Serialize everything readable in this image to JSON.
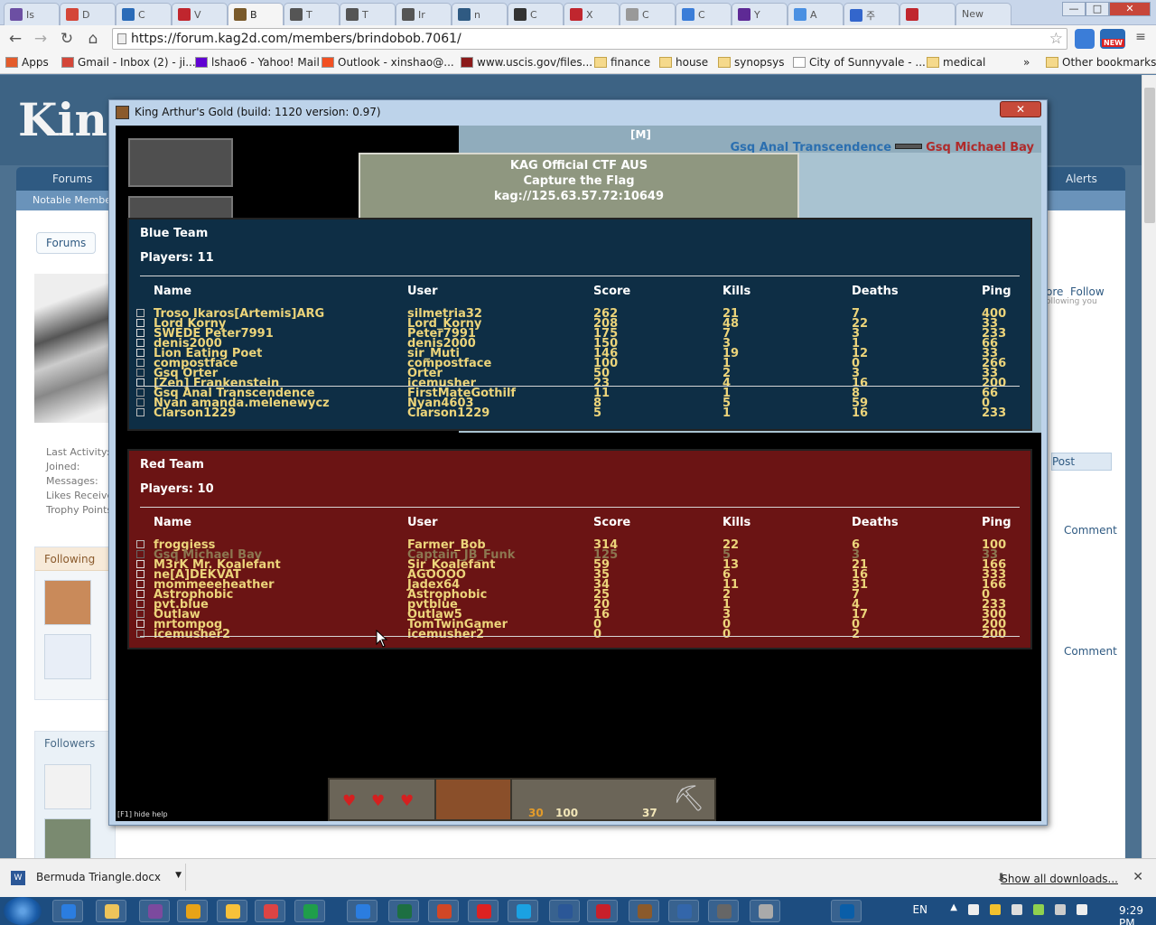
{
  "browser": {
    "tabs": [
      {
        "label": "Is",
        "color": "#6c4fa3"
      },
      {
        "label": "D",
        "color": "#d44638"
      },
      {
        "label": "C",
        "color": "#2a6bb8"
      },
      {
        "label": "V",
        "color": "#c0262e"
      },
      {
        "label": "B",
        "color": "#7a5a2a",
        "active": true
      },
      {
        "label": "T",
        "color": "#555555"
      },
      {
        "label": "T",
        "color": "#555555"
      },
      {
        "label": "Ir",
        "color": "#555555"
      },
      {
        "label": "n",
        "color": "#2f5a82"
      },
      {
        "label": "C",
        "color": "#333333"
      },
      {
        "label": "X",
        "color": "#c0262e"
      },
      {
        "label": "C",
        "color": "#999999"
      },
      {
        "label": "C",
        "color": "#3b7dd8"
      },
      {
        "label": "Y",
        "color": "#5e2a95"
      },
      {
        "label": "A",
        "color": "#4a90e2"
      },
      {
        "label": "주",
        "color": "#3366cc"
      },
      {
        "label": "",
        "color": "#c0262e"
      },
      {
        "label": "New",
        "color": ""
      }
    ],
    "url": "https://forum.kag2d.com/members/brindobob.7061/",
    "bookmarks": [
      {
        "label": "Apps",
        "kind": "apps"
      },
      {
        "label": "Gmail - Inbox (2) - ji...",
        "kind": "gmail"
      },
      {
        "label": "lshao6 - Yahoo! Mail",
        "kind": "yahoo"
      },
      {
        "label": "Outlook - xinshao@...",
        "kind": "ms"
      },
      {
        "label": "www.uscis.gov/files...",
        "kind": "gov"
      },
      {
        "label": "finance",
        "kind": "folder"
      },
      {
        "label": "house",
        "kind": "folder"
      },
      {
        "label": "synopsys",
        "kind": "folder"
      },
      {
        "label": "City of Sunnyvale - ...",
        "kind": "page"
      },
      {
        "label": "medical",
        "kind": "folder"
      }
    ],
    "bookmark_more": "»",
    "other_bookmarks": "Other bookmarks",
    "ext_new": "NEW"
  },
  "forum": {
    "logo": "King",
    "nav_forums": "Forums",
    "nav_alerts": "Alerts",
    "subnav_notable": "Notable Members",
    "crumb_forums": "Forums",
    "info_lines": [
      "Last Activity:",
      "Joined:",
      "Messages:",
      "Likes Received:",
      "Trophy Points:"
    ],
    "following": "Following",
    "followers": "Followers",
    "follow_link": "Follow",
    "more_link": "ore",
    "following_you": "ollowing you",
    "post_button": "Post",
    "comment": "Comment"
  },
  "game": {
    "window_title": "King Arthur's Gold (build: 1120 version: 0.97)",
    "close_label": "✕",
    "m_tag": "[M]",
    "killfeed": {
      "killer": "Gsq Anal Transcendence",
      "victim": "Gsq Michael Bay"
    },
    "server": {
      "name": "KAG Official CTF AUS",
      "mode": "Capture the Flag",
      "address": "kag://125.63.57.72:10649"
    },
    "columns": {
      "name": "Name",
      "user": "User",
      "score": "Score",
      "kills": "Kills",
      "deaths": "Deaths",
      "ping": "Ping"
    },
    "blue": {
      "title": "Blue Team",
      "count": "Players: 11",
      "players": [
        {
          "name": "Troso Ikaros[Artemis]ARG",
          "user": "silmetria32",
          "score": "262",
          "kills": "21",
          "deaths": "7",
          "ping": "400",
          "cls": "builder"
        },
        {
          "name": "Lord Korny",
          "user": "Lord_Korny",
          "score": "208",
          "kills": "48",
          "deaths": "22",
          "ping": "33",
          "cls": "knight"
        },
        {
          "name": "SWEDE Peter7991",
          "user": "Peter7991",
          "score": "175",
          "kills": "7",
          "deaths": "3",
          "ping": "233",
          "cls": "knight"
        },
        {
          "name": "denis2000",
          "user": "denis2000",
          "score": "150",
          "kills": "3",
          "deaths": "1",
          "ping": "66",
          "cls": "knight"
        },
        {
          "name": "Lion Eating Poet",
          "user": "sir_Muti",
          "score": "146",
          "kills": "19",
          "deaths": "12",
          "ping": "33",
          "cls": "knight"
        },
        {
          "name": "compostface",
          "user": "compostface",
          "score": "100",
          "kills": "1",
          "deaths": "0",
          "ping": "266",
          "cls": "builder"
        },
        {
          "name": "Gsq Orter",
          "user": "Orter",
          "score": "50",
          "kills": "2",
          "deaths": "3",
          "ping": "33",
          "cls": "archer"
        },
        {
          "name": "[Zen] Frankenstein",
          "user": "icemusher",
          "score": "23",
          "kills": "4",
          "deaths": "16",
          "ping": "200",
          "cls": "knight"
        },
        {
          "name": "Gsq Anal Transcendence",
          "user": "FirstMateGothilf",
          "score": "11",
          "kills": "1",
          "deaths": "8",
          "ping": "66",
          "cls": "archer"
        },
        {
          "name": "Nyan amanda.melenewycz",
          "user": "Nyan4603",
          "score": "8",
          "kills": "5",
          "deaths": "59",
          "ping": "0",
          "cls": "archer"
        },
        {
          "name": "Clarson1229",
          "user": "Clarson1229",
          "score": "5",
          "kills": "1",
          "deaths": "16",
          "ping": "233",
          "cls": "builder"
        }
      ]
    },
    "red": {
      "title": "Red Team",
      "count": "Players: 10",
      "players": [
        {
          "name": "froggiess",
          "user": "Farmer_Bob",
          "score": "314",
          "kills": "22",
          "deaths": "6",
          "ping": "100",
          "cls": "builder"
        },
        {
          "name": "Gsq Michael Bay",
          "user": "Captain_JB_Funk",
          "score": "125",
          "kills": "5",
          "deaths": "3",
          "ping": "33",
          "cls": "dead"
        },
        {
          "name": "M3rK Mr. Koalefant",
          "user": "Sir_Koalefant",
          "score": "59",
          "kills": "13",
          "deaths": "21",
          "ping": "166",
          "cls": "knight"
        },
        {
          "name": "ne[A]DEKVAT",
          "user": "AGOOOO",
          "score": "35",
          "kills": "6",
          "deaths": "16",
          "ping": "333",
          "cls": "knight"
        },
        {
          "name": "mommeeeheather",
          "user": "Jadex64",
          "score": "34",
          "kills": "11",
          "deaths": "31",
          "ping": "166",
          "cls": "knight"
        },
        {
          "name": "Astrophobic",
          "user": "Astrophobic",
          "score": "25",
          "kills": "2",
          "deaths": "7",
          "ping": "0",
          "cls": "knight"
        },
        {
          "name": "pvt.blue",
          "user": "pvtblue",
          "score": "20",
          "kills": "1",
          "deaths": "4",
          "ping": "233",
          "cls": "builder"
        },
        {
          "name": "Outlaw",
          "user": "Outlaw5",
          "score": "16",
          "kills": "3",
          "deaths": "17",
          "ping": "300",
          "cls": "archer"
        },
        {
          "name": "mrtompog",
          "user": "TomTwinGamer",
          "score": "0",
          "kills": "0",
          "deaths": "0",
          "ping": "200",
          "cls": "knight"
        },
        {
          "name": "icemusher2",
          "user": "icemusher2",
          "score": "0",
          "kills": "0",
          "deaths": "2",
          "ping": "200",
          "cls": "archer"
        }
      ]
    },
    "hud": {
      "arrows": "30",
      "wood": "100",
      "coins": "37"
    },
    "help_hint": "[F1] hide help"
  },
  "downloads": {
    "file": "Bermuda Triangle.docx",
    "show_all": "Show all downloads...",
    "close": "✕"
  },
  "taskbar": {
    "lang": "EN",
    "time": "9:29 PM"
  }
}
